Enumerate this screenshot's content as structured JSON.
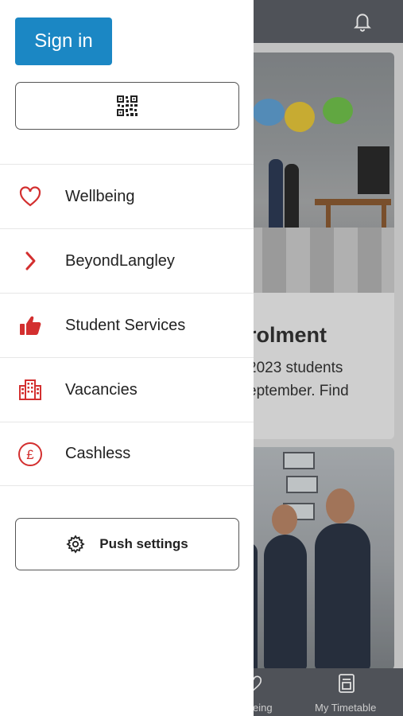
{
  "background_app": {
    "header_icon": "bell-icon",
    "card1": {
      "title_fragment": "rolment",
      "text_lines": [
        "2023 students",
        "eptember. Find"
      ]
    },
    "tab_bar": {
      "tabs": [
        {
          "label": "eing",
          "icon": "heart-icon"
        },
        {
          "label": "My Timetable",
          "icon": "timetable-icon"
        }
      ]
    }
  },
  "drawer": {
    "sign_in_label": "Sign in",
    "sign_in_color": "#1b87c4",
    "qr_button_icon": "qr-code-icon",
    "accent_color": "#d32f2f",
    "menu": [
      {
        "label": "Wellbeing",
        "icon": "heart-icon"
      },
      {
        "label": "BeyondLangley",
        "icon": "chevron-right-icon"
      },
      {
        "label": "Student Services",
        "icon": "thumbs-up-icon"
      },
      {
        "label": "Vacancies",
        "icon": "building-icon"
      },
      {
        "label": "Cashless",
        "icon": "pound-icon"
      }
    ],
    "push_settings_label": "Push settings",
    "push_settings_icon": "gear-icon"
  }
}
